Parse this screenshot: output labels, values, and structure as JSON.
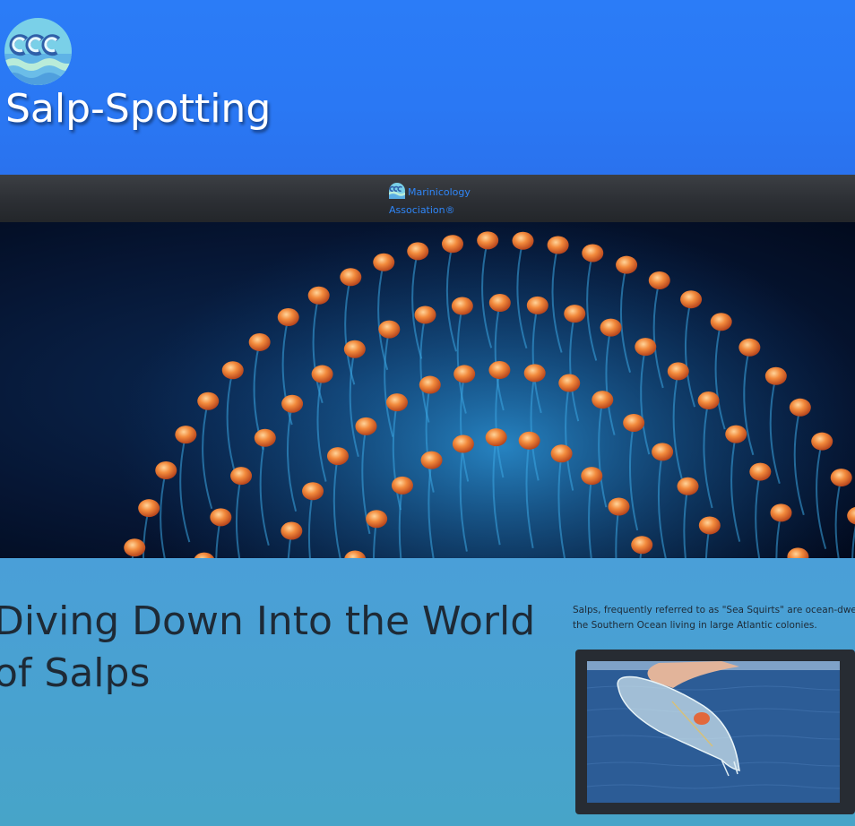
{
  "header": {
    "site_title": "Salp-Spotting",
    "logo_icon": "waves-logo-icon"
  },
  "navbar": {
    "brand_label": "Marinicology Association®",
    "brand_icon": "waves-logo-icon"
  },
  "hero": {
    "image": "salp-chain-photo"
  },
  "main": {
    "headline": "Diving Down Into the World of Salps",
    "intro": "Salps, frequently referred to as \"Sea Squirts\" are ocean-dwe... the Southern Ocean living in large Atlantic colonies.",
    "intro_line_1": "Salps, frequently referred to as \"Sea Squirts\" are ocean-dwe",
    "intro_line_2": "the Southern Ocean living in large Atlantic colonies.",
    "photo": "hand-holding-salp-photo"
  },
  "colors": {
    "header_blue": "#2b7cf7",
    "navbar_dark": "#2c2f34",
    "link_blue": "#2f86f8",
    "content_blue": "#4a9fd8",
    "text_dark": "#1e2a36"
  }
}
